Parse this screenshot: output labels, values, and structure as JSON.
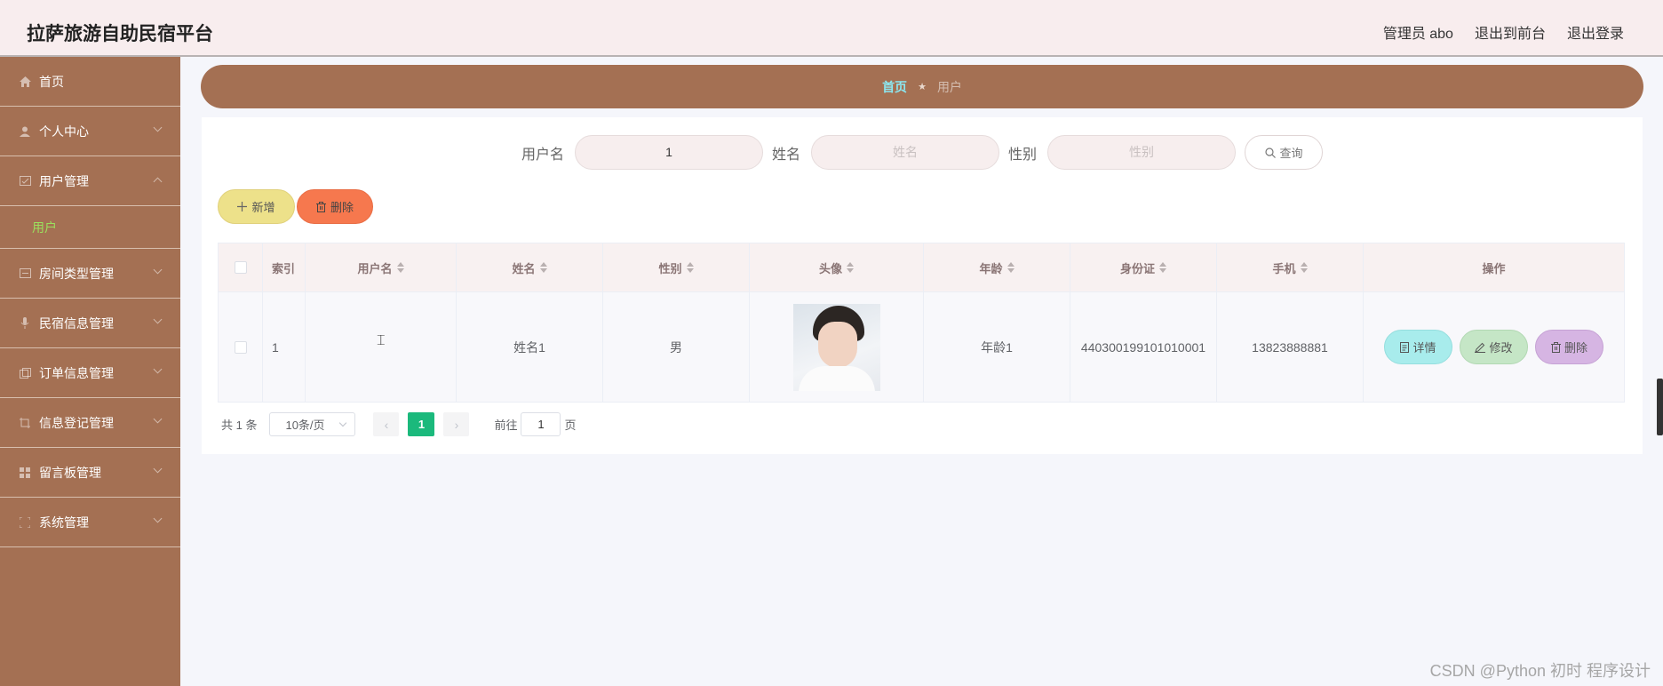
{
  "header": {
    "title": "拉萨旅游自助民宿平台",
    "user_label": "管理员 abo",
    "to_front": "退出到前台",
    "logout": "退出登录"
  },
  "sidebar": {
    "items": [
      {
        "label": "首页",
        "icon": "home-icon",
        "expandable": false
      },
      {
        "label": "个人中心",
        "icon": "person-icon",
        "expandable": true
      },
      {
        "label": "用户管理",
        "icon": "user-mgmt-icon",
        "expandable": true,
        "expanded": true
      },
      {
        "label": "房间类型管理",
        "icon": "room-icon",
        "expandable": true
      },
      {
        "label": "民宿信息管理",
        "icon": "mic-icon",
        "expandable": true
      },
      {
        "label": "订单信息管理",
        "icon": "order-icon",
        "expandable": true
      },
      {
        "label": "信息登记管理",
        "icon": "register-icon",
        "expandable": true
      },
      {
        "label": "留言板管理",
        "icon": "grid-icon",
        "expandable": true
      },
      {
        "label": "系统管理",
        "icon": "system-icon",
        "expandable": true
      }
    ],
    "submenu": {
      "label": "用户",
      "active_color": "#9be15d"
    }
  },
  "breadcrumb": {
    "home": "首页",
    "separator": "★",
    "current": "用户"
  },
  "search": {
    "username_label": "用户名",
    "username_value": "1",
    "name_label": "姓名",
    "name_placeholder": "姓名",
    "gender_label": "性别",
    "gender_placeholder": "性别",
    "query_label": "查询"
  },
  "actions": {
    "add_label": "新增",
    "delete_label": "删除"
  },
  "table": {
    "columns": [
      "索引",
      "用户名",
      "姓名",
      "性别",
      "头像",
      "年龄",
      "身份证",
      "手机",
      "操作"
    ],
    "rows": [
      {
        "index": "1",
        "username": "",
        "name": "姓名1",
        "gender": "男",
        "avatar": "avatar-photo",
        "age": "年龄1",
        "id_card": "440300199101010001",
        "phone": "13823888881"
      }
    ],
    "row_actions": {
      "detail": "详情",
      "edit": "修改",
      "delete": "删除"
    }
  },
  "pagination": {
    "total": "共 1 条",
    "page_size": "10条/页",
    "current_page": "1",
    "goto_label": "前往",
    "goto_value": "1",
    "page_suffix": "页"
  },
  "watermark": "CSDN @Python 初时 程序设计",
  "colors": {
    "header_bg": "#f8edee",
    "sidebar_bg": "#a47053",
    "accent_green": "#1bb97c",
    "add_btn": "#ede18a",
    "delete_btn": "#f6784e",
    "detail_btn": "#a8ecec",
    "edit_btn": "#c5e6c6",
    "row_delete_btn": "#d6b5e3"
  }
}
